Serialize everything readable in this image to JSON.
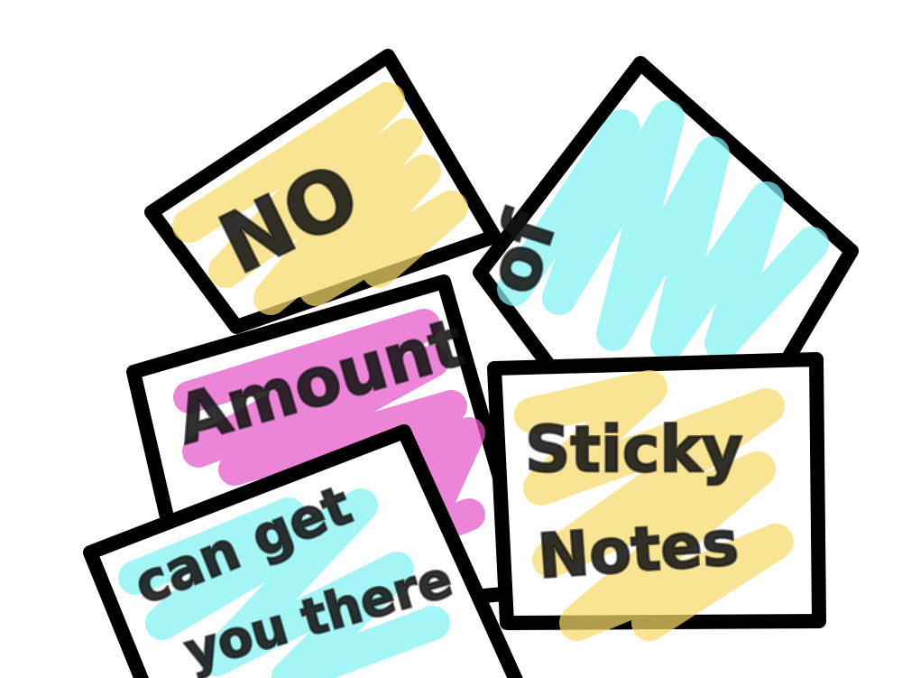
{
  "colors": {
    "background": "#ffffff",
    "outline": "#000000",
    "ink": "#141414",
    "yellow": "#f6d96a",
    "cyan": "#80f1f3",
    "magenta": "#e455c8"
  },
  "notes": [
    {
      "id": "no",
      "text": "NO",
      "highlight": "yellow"
    },
    {
      "id": "of",
      "text": "of",
      "highlight": "cyan"
    },
    {
      "id": "amount",
      "text": "Amount",
      "highlight": "magenta"
    },
    {
      "id": "sticky",
      "text": "Sticky",
      "highlight": "yellow"
    },
    {
      "id": "notes",
      "text": "Notes",
      "highlight": "yellow"
    },
    {
      "id": "canget",
      "text": "can get",
      "highlight": "cyan"
    },
    {
      "id": "youthere",
      "text": "you there",
      "highlight": "cyan"
    }
  ]
}
